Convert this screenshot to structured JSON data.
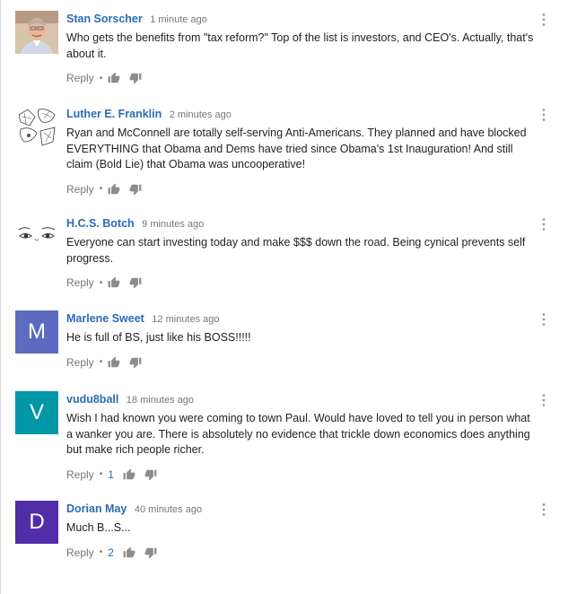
{
  "comments": [
    {
      "author": "Stan Sorscher",
      "time": "1 minute ago",
      "text": "Who gets the benefits from \"tax reform?\" Top of the list is investors, and CEO's. Actually, that's about it.",
      "reply_label": "Reply",
      "avatar": {
        "kind": "photo",
        "icon": "person-photo"
      }
    },
    {
      "author": "Luther E. Franklin",
      "time": "2 minutes ago",
      "text": "Ryan and McConnell are totally self-serving Anti-Americans. They planned and have blocked EVERYTHING that Obama and Dems have tried since Obama's 1st Inauguration! And still claim (Bold Lie) that Obama was uncooperative!",
      "reply_label": "Reply",
      "avatar": {
        "kind": "sketch",
        "icon": "sketch-drawing"
      }
    },
    {
      "author": "H.C.S. Botch",
      "time": "9 minutes ago",
      "text": "Everyone can start investing today and make $$$ down the road. Being cynical prevents self progress.",
      "reply_label": "Reply",
      "avatar": {
        "kind": "eyes",
        "icon": "eyes-drawing"
      }
    },
    {
      "author": "Marlene Sweet",
      "time": "12 minutes ago",
      "text": "He is full of BS, just like his BOSS!!!!!",
      "reply_label": "Reply",
      "avatar": {
        "kind": "letter",
        "letter": "M",
        "color": "#5c6bc0"
      }
    },
    {
      "author": "vudu8ball",
      "time": "18 minutes ago",
      "text": "Wish I had known you were coming to town Paul.  Would have loved to tell you in person what a wanker you are.  There is absolutely no evidence that trickle down economics does anything but make rich people richer.",
      "reply_label": "Reply",
      "likes": "1",
      "avatar": {
        "kind": "letter",
        "letter": "V",
        "color": "#0097a7"
      }
    },
    {
      "author": "Dorian May",
      "time": "40 minutes ago",
      "text": "Much B...S...",
      "reply_label": "Reply",
      "likes": "2",
      "avatar": {
        "kind": "letter",
        "letter": "D",
        "color": "#512da8"
      }
    }
  ],
  "colors": {
    "author_link": "#2b6bb5",
    "meta_text": "#767676",
    "body_text": "#222222",
    "icon": "#8c8c8c"
  },
  "icons": {
    "like": "thumb-up-icon",
    "dislike": "thumb-down-icon",
    "menu": "more-vert-icon"
  }
}
